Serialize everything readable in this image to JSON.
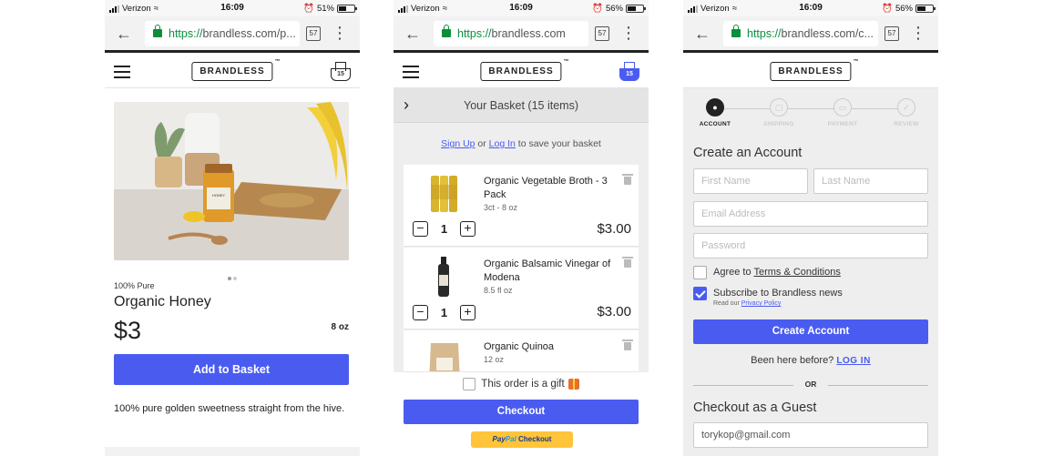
{
  "status": {
    "p1": {
      "carrier": "Verizon",
      "time": "16:09",
      "battery": "51%",
      "battery_level": 0.51
    },
    "p2": {
      "carrier": "Verizon",
      "time": "16:09",
      "battery": "56%",
      "battery_level": 0.56
    },
    "p3": {
      "carrier": "Verizon",
      "time": "16:09",
      "battery": "56%",
      "battery_level": 0.56
    }
  },
  "browser": {
    "p1": {
      "scheme": "https://",
      "rest": "brandless.com/p..."
    },
    "p2": {
      "scheme": "https://",
      "rest": "brandless.com"
    },
    "p3": {
      "scheme": "https://",
      "rest": "brandless.com/c..."
    },
    "tabs_count": "57"
  },
  "site": {
    "logo": "BRANDLESS",
    "tm": "™",
    "basket_count": "15"
  },
  "product": {
    "subtitle": "100% Pure",
    "title": "Organic Honey",
    "price": "$3",
    "size": "8 oz",
    "add_button": "Add to Basket",
    "description": "100% pure golden sweetness straight from the hive.",
    "image_label": "HONEY"
  },
  "basket": {
    "header": "Your Basket (15 items)",
    "signup": "Sign Up",
    "or": " or ",
    "login": "Log In",
    "save_text": " to save your basket",
    "items": [
      {
        "name": "Organic Vegetable Broth - 3 Pack",
        "meta": "3ct - 8 oz",
        "qty": "1",
        "price": "$3.00"
      },
      {
        "name": "Organic Balsamic Vinegar of Modena",
        "meta": "8.5 fl oz",
        "qty": "1",
        "price": "$3.00"
      },
      {
        "name": "Organic Quinoa",
        "meta": "12 oz",
        "qty": "",
        "price": ""
      }
    ],
    "gift_label": "This order is a gift",
    "checkout": "Checkout",
    "paypal_pay": "Pay",
    "paypal_pal": "Pal",
    "paypal_checkout": " Checkout"
  },
  "account": {
    "steps": [
      "ACCOUNT",
      "SHIPPING",
      "PAYMENT",
      "REVIEW"
    ],
    "create_heading": "Create an Account",
    "first_name_placeholder": "First Name",
    "last_name_placeholder": "Last Name",
    "email_placeholder": "Email Address",
    "password_placeholder": "Password",
    "agree_prefix": "Agree to ",
    "agree_link": "Terms & Conditions",
    "subscribe_label": "Subscribe to Brandless news",
    "privacy_prefix": "Read our ",
    "privacy_link": "Privacy Policy",
    "create_button": "Create Account",
    "been_here": "Been here before? ",
    "login_link": "LOG IN",
    "or": "OR",
    "guest_heading": "Checkout as a Guest",
    "guest_email": "torykop@gmail.com"
  }
}
